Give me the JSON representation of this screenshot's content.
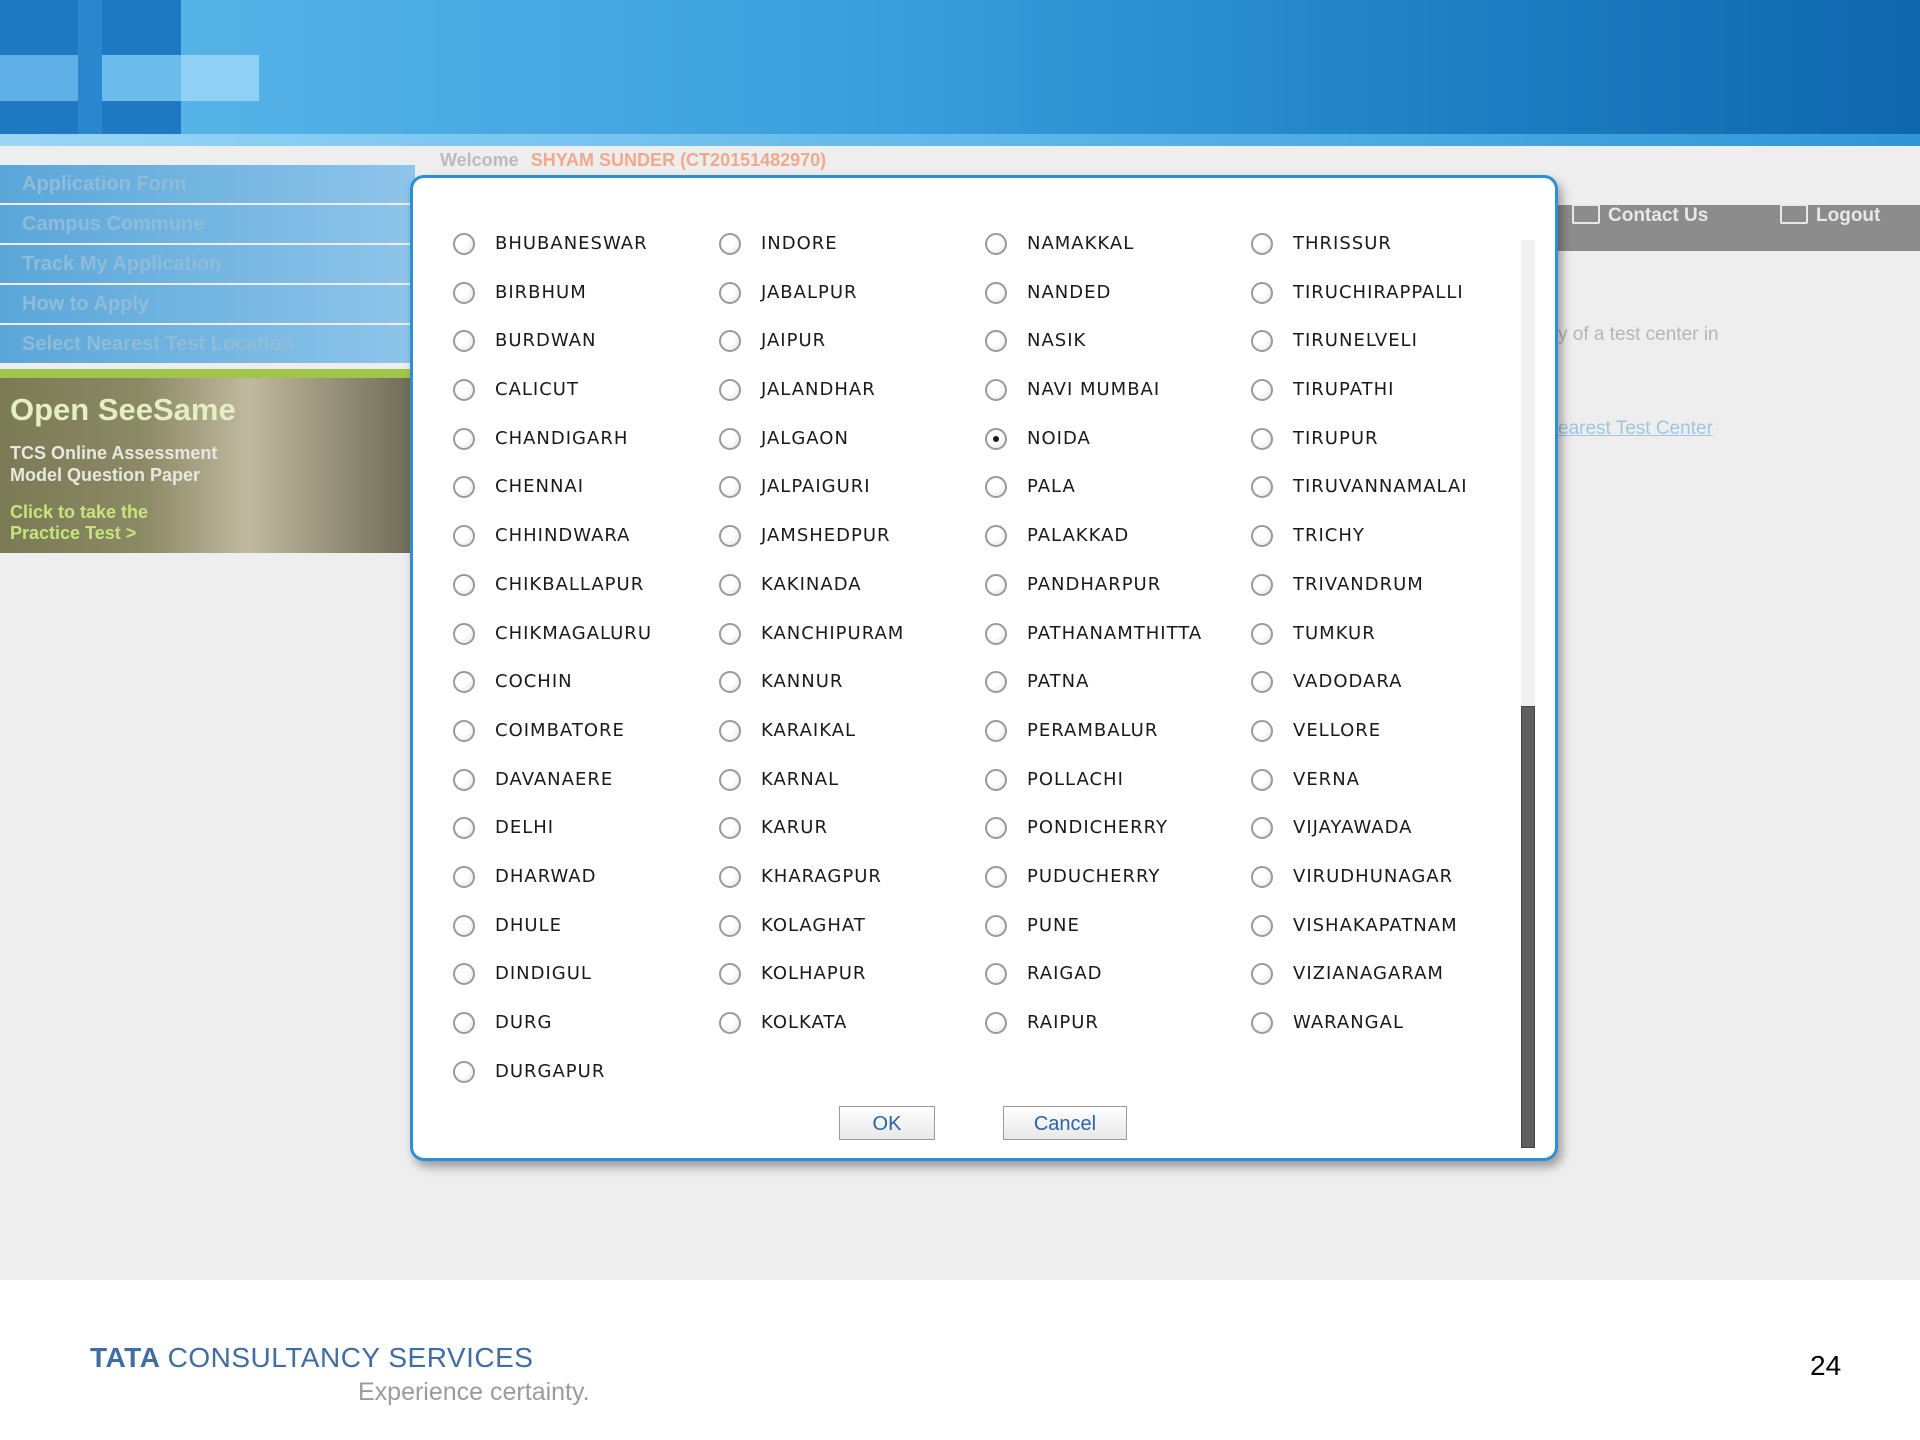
{
  "nav": {
    "items": [
      "Application Form",
      "Campus Commune",
      "Track My Application",
      "How to Apply",
      "Select Nearest Test Location"
    ]
  },
  "promo": {
    "title": "Open SeeSame",
    "subtitle": "TCS Online Assessment Model Question Paper",
    "cta": "Click to take the Practice Test >"
  },
  "welcome": {
    "label": "Welcome",
    "user": "SHYAM SUNDER  (CT20151482970)"
  },
  "toolbar": {
    "contact": "Contact Us",
    "logout": "Logout"
  },
  "background": {
    "text_fragment": "y of a test center in",
    "link_fragment": "earest Test Center"
  },
  "dialog": {
    "selected": "NOIDA",
    "columns": [
      [
        "BHUBANESWAR",
        "BIRBHUM",
        "BURDWAN",
        "CALICUT",
        "CHANDIGARH",
        "CHENNAI",
        "CHHINDWARA",
        "CHIKBALLAPUR",
        "CHIKMAGALURU",
        "COCHIN",
        "COIMBATORE",
        "DAVANAERE",
        "DELHI",
        "DHARWAD",
        "DHULE",
        "DINDIGUL",
        "DURG",
        "DURGAPUR"
      ],
      [
        "INDORE",
        "JABALPUR",
        "JAIPUR",
        "JALANDHAR",
        "JALGAON",
        "JALPAIGURI",
        "JAMSHEDPUR",
        "KAKINADA",
        "KANCHIPURAM",
        "KANNUR",
        "KARAIKAL",
        "KARNAL",
        "KARUR",
        "KHARAGPUR",
        "KOLAGHAT",
        "KOLHAPUR",
        "KOLKATA"
      ],
      [
        "NAMAKKAL",
        "NANDED",
        "NASIK",
        "NAVI MUMBAI",
        "NOIDA",
        "PALA",
        "PALAKKAD",
        "PANDHARPUR",
        "PATHANAMTHITTA",
        "PATNA",
        "PERAMBALUR",
        "POLLACHI",
        "PONDICHERRY",
        "PUDUCHERRY",
        "PUNE",
        "RAIGAD",
        "RAIPUR"
      ],
      [
        "THRISSUR",
        "TIRUCHIRAPPALLI",
        "TIRUNELVELI",
        "TIRUPATHI",
        "TIRUPUR",
        "TIRUVANNAMALAI",
        "TRICHY",
        "TRIVANDRUM",
        "TUMKUR",
        "VADODARA",
        "VELLORE",
        "VERNA",
        "VIJAYAWADA",
        "VIRUDHUNAGAR",
        "VISHAKAPATNAM",
        "VIZIANAGARAM",
        "WARANGAL"
      ]
    ],
    "ok_label": "OK",
    "cancel_label": "Cancel"
  },
  "footer": {
    "brand_bold": "TATA",
    "brand_rest": "CONSULTANCY SERVICES",
    "tagline": "Experience certainty.",
    "page_number": "24"
  }
}
